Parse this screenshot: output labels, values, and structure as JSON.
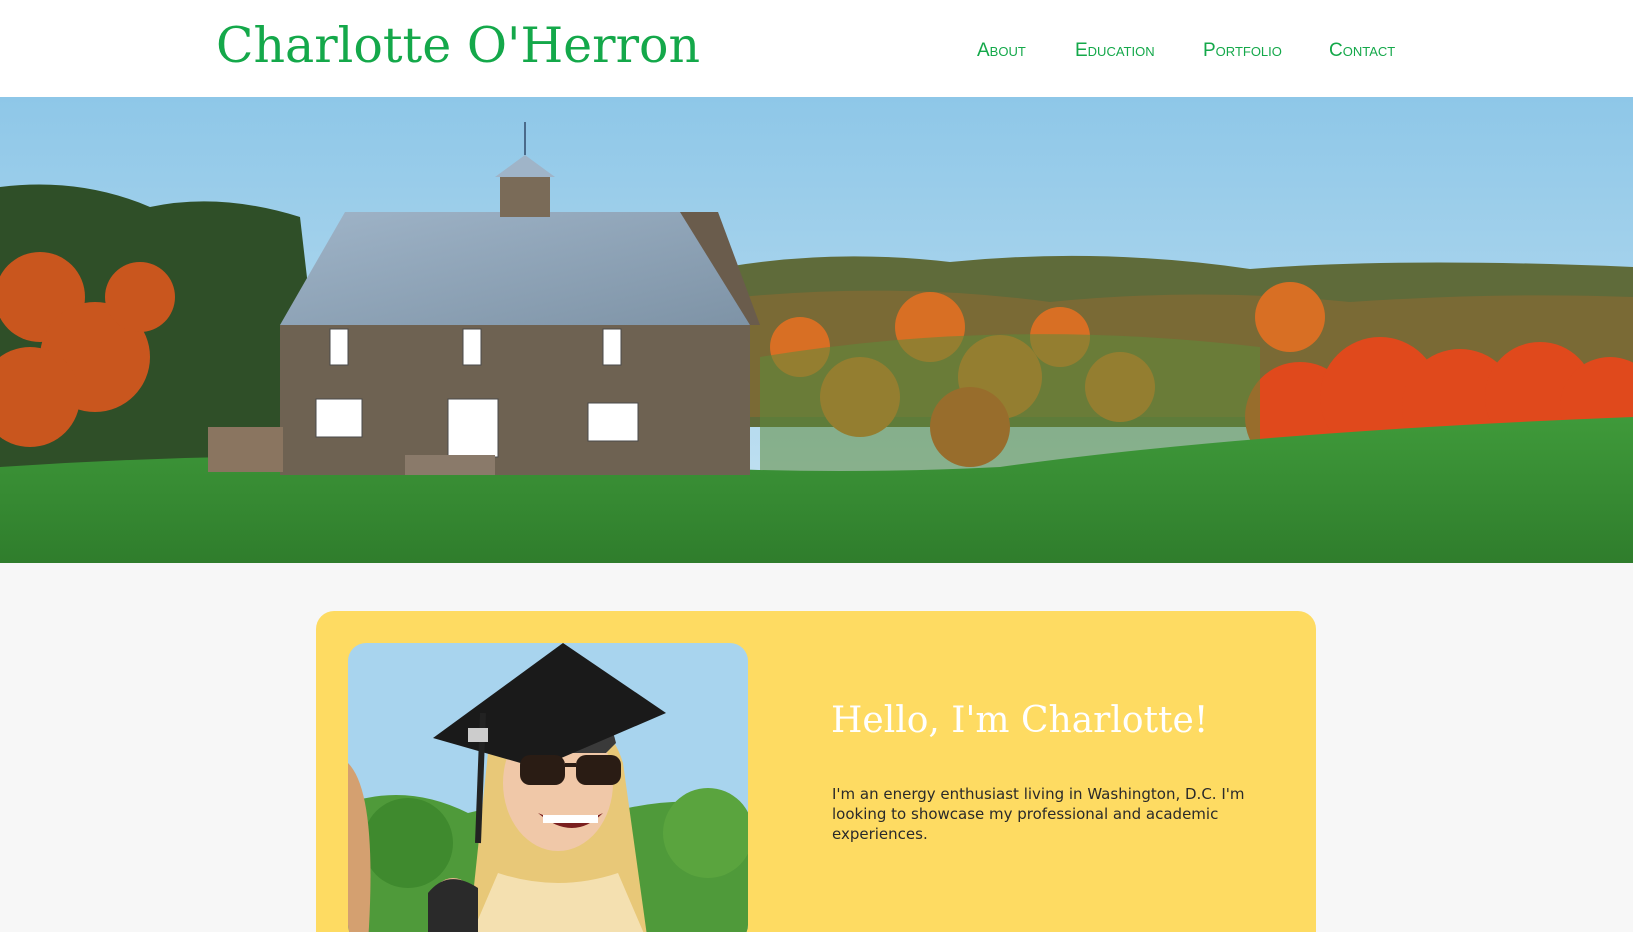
{
  "header": {
    "site_title": "Charlotte O'Herron",
    "nav": [
      {
        "label": "About"
      },
      {
        "label": "Education"
      },
      {
        "label": "Portfolio"
      },
      {
        "label": "Contact"
      }
    ]
  },
  "intro_card": {
    "heading": "Hello, I'm Charlotte!",
    "body": "I'm an energy enthusiast living in Washington, D.C. I'm looking to showcase my professional and academic experiences."
  },
  "colors": {
    "brand_green": "#14a84a",
    "card_yellow": "#fedb62",
    "heading_white": "#ffffff",
    "body_text": "#2a2a2a"
  },
  "images": {
    "hero": "hero-image-barn-autumn-landscape",
    "portrait": "profile-photo-graduation"
  }
}
